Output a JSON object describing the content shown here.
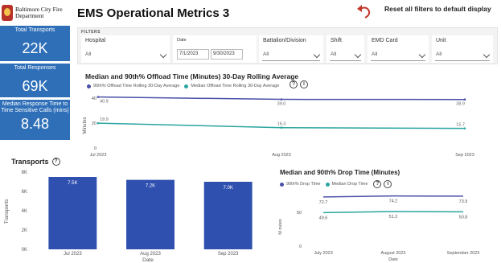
{
  "header": {
    "dept_line1": "Baltimore City Fire",
    "dept_line2": "Department",
    "title": "EMS Operational Metrics 3",
    "reset_label": "Reset all filters to default display"
  },
  "kpis": [
    {
      "label": "Total Transports",
      "value": "22K"
    },
    {
      "label": "Total Responses",
      "value": "69K"
    },
    {
      "label": "Median Response Time to Time Sensitive Calls (mins)",
      "value": "8.48"
    }
  ],
  "filters": {
    "section_title": "FILTERS",
    "hospital": {
      "label": "Hospital",
      "value": "All"
    },
    "date": {
      "label": "Date",
      "start": "7/1/2023",
      "end": "9/30/2023"
    },
    "battalion": {
      "label": "Battalion/Division",
      "value": "All"
    },
    "shift": {
      "label": "Shift",
      "value": "All"
    },
    "emd_card": {
      "label": "EMD Card",
      "value": "All"
    },
    "unit": {
      "label": "Unit",
      "value": "All"
    }
  },
  "colors": {
    "accent": "#2e6fb8",
    "bar": "#3050b0",
    "series_purple": "#4a4fa8",
    "series_teal": "#2aa5a0"
  },
  "chart_data": [
    {
      "type": "line",
      "title": "Median and 90th% Offload Time (Minutes) 30-Day Rolling Average",
      "legend": [
        "90th% Offload Time Rolling 30-Day Average",
        "Median Offload Time Rolling 30-Day Average"
      ],
      "ylabel": "Minutes",
      "x": [
        "Jul 2023",
        "Aug 2023",
        "Sep 2023"
      ],
      "yticks": [
        "0",
        "20",
        "40"
      ],
      "ylim": [
        0,
        40
      ],
      "series": [
        {
          "name": "90th% Offload Time Rolling 30-Day Average",
          "values": [
            40.9,
            39.0,
            38.9
          ],
          "labels": [
            "40.9",
            "39.0",
            "38.9"
          ]
        },
        {
          "name": "Median Offload Time Rolling 30-Day Average",
          "values": [
            19.9,
            16.3,
            15.7
          ],
          "labels": [
            "19.9",
            "16.3",
            "15.7"
          ]
        }
      ]
    },
    {
      "type": "bar",
      "title": "Transports",
      "xlabel": "Date",
      "ylabel": "Transports",
      "categories": [
        "Jul 2023",
        "Aug 2023",
        "Sep 2023"
      ],
      "values": [
        7500,
        7200,
        7000
      ],
      "labels": [
        "7.5K",
        "7.2K",
        "7.0K"
      ],
      "yticks": [
        "0K",
        "2K",
        "4K",
        "6K",
        "8K"
      ],
      "ylim": [
        0,
        8000
      ]
    },
    {
      "type": "line",
      "title": "Median and 90th% Drop Time (Minutes)",
      "legend": [
        "90th% Drop Time",
        "Median Drop Time"
      ],
      "xlabel": "Date",
      "ylabel": "M nutes",
      "categories": [
        "July 2023",
        "August 2023",
        "September 2023"
      ],
      "yticks": [
        "0",
        "50"
      ],
      "ylim": [
        0,
        100
      ],
      "series": [
        {
          "name": "90th% Drop Time",
          "values": [
            72.7,
            74.2,
            73.9
          ],
          "labels": [
            "72.7",
            "74.2",
            "73.9"
          ]
        },
        {
          "name": "Median Drop Time",
          "values": [
            49.6,
            51.2,
            50.8
          ],
          "labels": [
            "49.6",
            "51.2",
            "50.8"
          ]
        }
      ]
    }
  ]
}
